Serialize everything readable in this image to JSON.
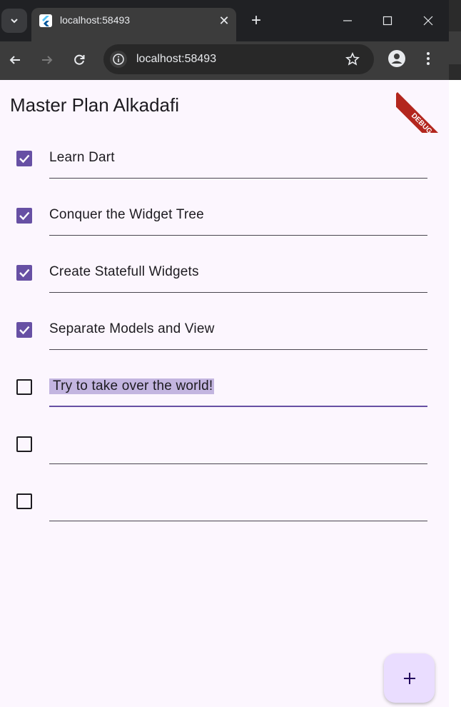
{
  "browser": {
    "tab_title": "localhost:58493",
    "url": "localhost:58493",
    "icons": {
      "tab_list": "chevron-down-icon",
      "favicon": "flutter-icon",
      "tab_close": "close-icon",
      "new_tab": "plus-icon",
      "minimize": "minimize-icon",
      "maximize": "maximize-icon",
      "close_window": "close-icon",
      "back": "arrow-left-icon",
      "forward": "arrow-right-icon",
      "reload": "reload-icon",
      "site_info": "info-icon",
      "bookmark": "star-icon",
      "profile": "profile-icon",
      "menu": "more-vert-icon"
    }
  },
  "app": {
    "title": "Master Plan Alkadafi",
    "debug_banner": "DEBUG",
    "tasks": [
      {
        "label": "Learn Dart",
        "done": true
      },
      {
        "label": "Conquer the Widget Tree",
        "done": true
      },
      {
        "label": "Create Statefull Widgets",
        "done": true
      },
      {
        "label": "Separate Models and View",
        "done": true
      },
      {
        "label": "Try to take over the world!",
        "done": false,
        "focused": true,
        "selected": true
      },
      {
        "label": "",
        "done": false
      },
      {
        "label": "",
        "done": false
      }
    ],
    "fab_icon": "plus-icon"
  },
  "colors": {
    "primary": "#6750a4",
    "surface": "#fcf6fe",
    "fab": "#eaddff",
    "selection": "#c3b5e0",
    "debug_banner": "#b3261e"
  }
}
